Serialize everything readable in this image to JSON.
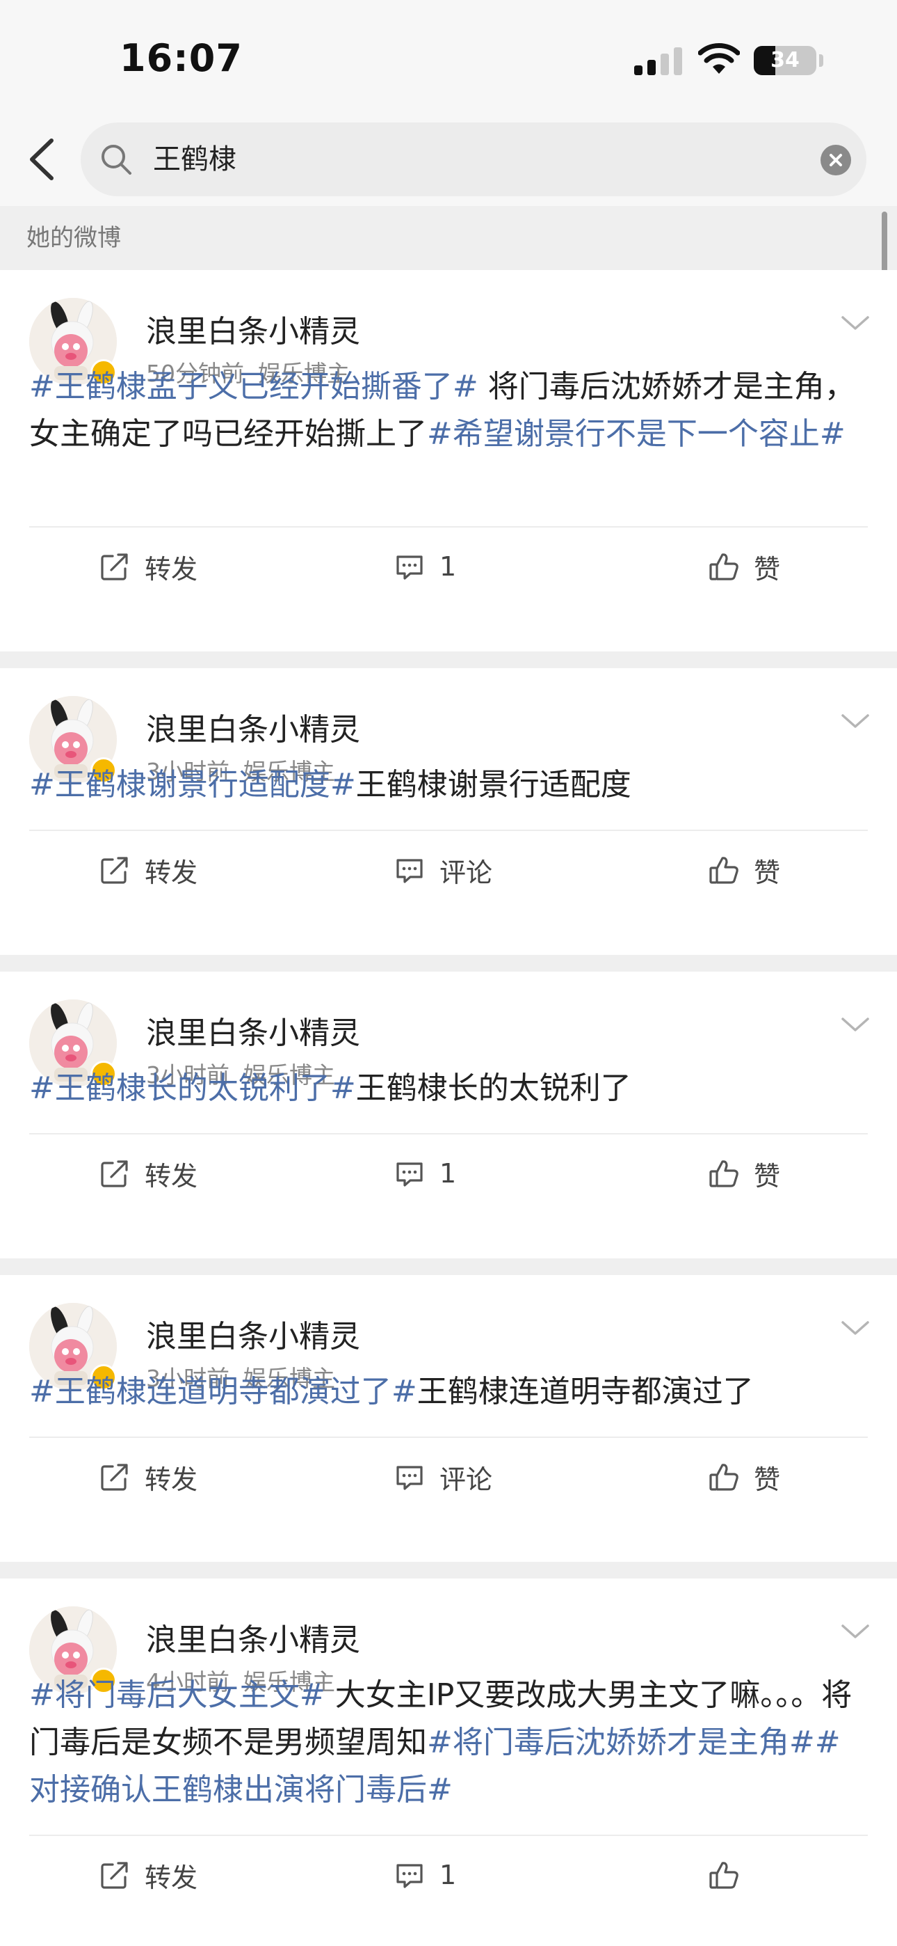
{
  "status_bar": {
    "time": "16:07",
    "battery": "34",
    "battery_level": 0.34
  },
  "search": {
    "query": "王鹤棣"
  },
  "section": {
    "title": "她的微博"
  },
  "posts": [
    {
      "author": "浪里白条小精灵",
      "time": "50分钟前",
      "source": "娱乐博主",
      "content": [
        {
          "text": "#王鹤棣孟子义已经开始撕番了#",
          "tag": true
        },
        {
          "text": " 将门毒后沈娇娇才是主角，女主确定了吗已经开始撕上了",
          "tag": false
        },
        {
          "text": "#希望谢景行不是下一个容止#",
          "tag": true
        }
      ],
      "repost": "转发",
      "comment": "1",
      "like": "赞"
    },
    {
      "author": "浪里白条小精灵",
      "time": "3小时前",
      "source": "娱乐博主",
      "content": [
        {
          "text": "#王鹤棣谢景行适配度#",
          "tag": true
        },
        {
          "text": "王鹤棣谢景行适配度",
          "tag": false
        }
      ],
      "repost": "转发",
      "comment": "评论",
      "like": "赞"
    },
    {
      "author": "浪里白条小精灵",
      "time": "3小时前",
      "source": "娱乐博主",
      "content": [
        {
          "text": "#王鹤棣长的太锐利了#",
          "tag": true
        },
        {
          "text": "王鹤棣长的太锐利了",
          "tag": false
        }
      ],
      "repost": "转发",
      "comment": "1",
      "like": "赞"
    },
    {
      "author": "浪里白条小精灵",
      "time": "3小时前",
      "source": "娱乐博主",
      "content": [
        {
          "text": "#王鹤棣连道明寺都演过了#",
          "tag": true
        },
        {
          "text": "王鹤棣连道明寺都演过了",
          "tag": false
        }
      ],
      "repost": "转发",
      "comment": "评论",
      "like": "赞"
    },
    {
      "author": "浪里白条小精灵",
      "time": "4小时前",
      "source": "娱乐博主",
      "content": [
        {
          "text": "#将门毒后大女主文#",
          "tag": true
        },
        {
          "text": " 大女主IP又要改成大男主文了嘛。。。将门毒后是女频不是男频望周知",
          "tag": false
        },
        {
          "text": "#将门毒后沈娇娇才是主角#",
          "tag": true
        },
        {
          "text": "#对接确认王鹤棣出演将门毒后#",
          "tag": true
        }
      ],
      "repost": "转发",
      "comment": "1",
      "like": ""
    }
  ],
  "colors": {
    "topic_link": "#4c6ea8",
    "verified_badge": "#f5b800",
    "separator": "#efefef"
  },
  "icons": {
    "back": "chevron-left-icon",
    "search": "magnifier-icon",
    "clear": "close-circle-icon",
    "more": "chevron-down-icon",
    "repost": "share-square-icon",
    "comment": "speech-bubble-icon",
    "like": "thumbs-up-icon"
  }
}
